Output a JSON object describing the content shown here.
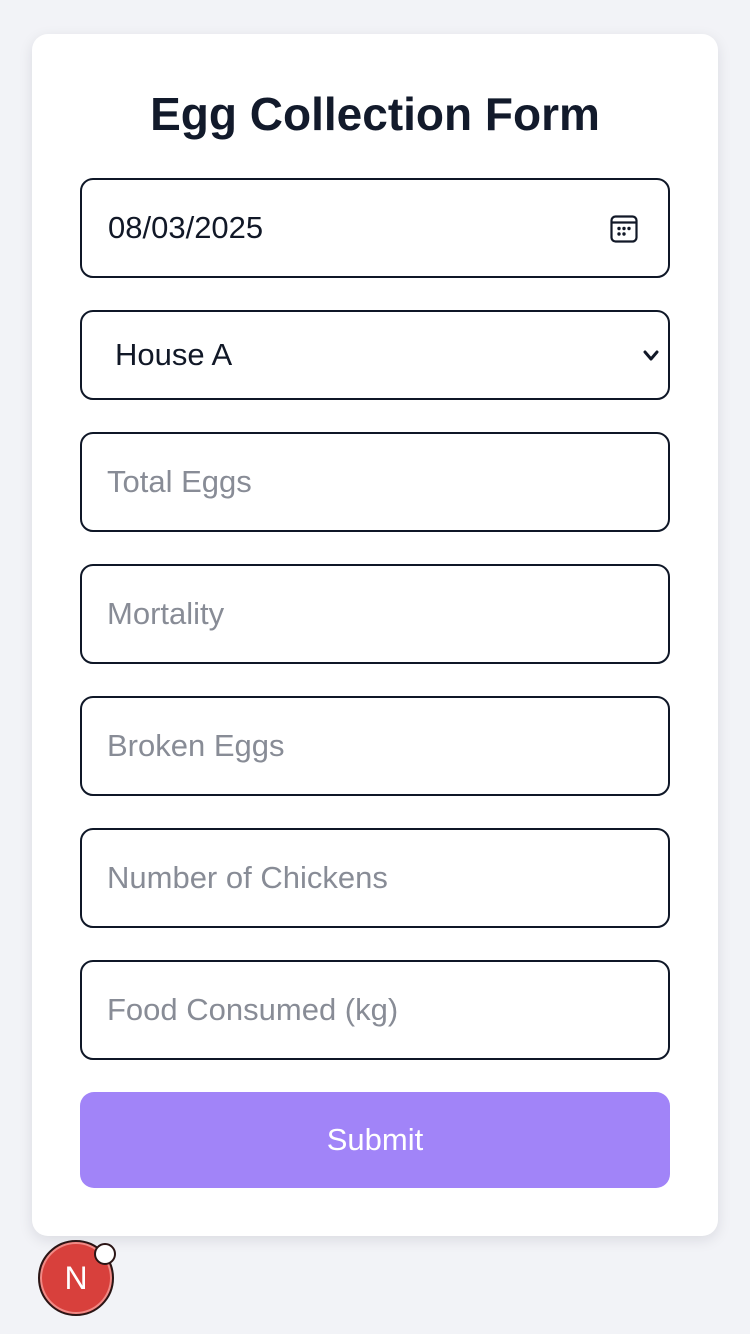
{
  "form": {
    "title": "Egg Collection Form",
    "date_value": "08/03/2025",
    "house_selected": "House A",
    "fields": [
      {
        "placeholder": "Total Eggs"
      },
      {
        "placeholder": "Mortality"
      },
      {
        "placeholder": "Broken Eggs"
      },
      {
        "placeholder": "Number of Chickens"
      },
      {
        "placeholder": "Food Consumed (kg)"
      }
    ],
    "submit_label": "Submit"
  },
  "badge": {
    "letter": "N"
  },
  "icons": {
    "date": "calendar-icon",
    "select": "chevron-down-icon"
  },
  "colors": {
    "accent": "#a184f8",
    "badge": "#d8403c",
    "background": "#f2f3f7"
  }
}
